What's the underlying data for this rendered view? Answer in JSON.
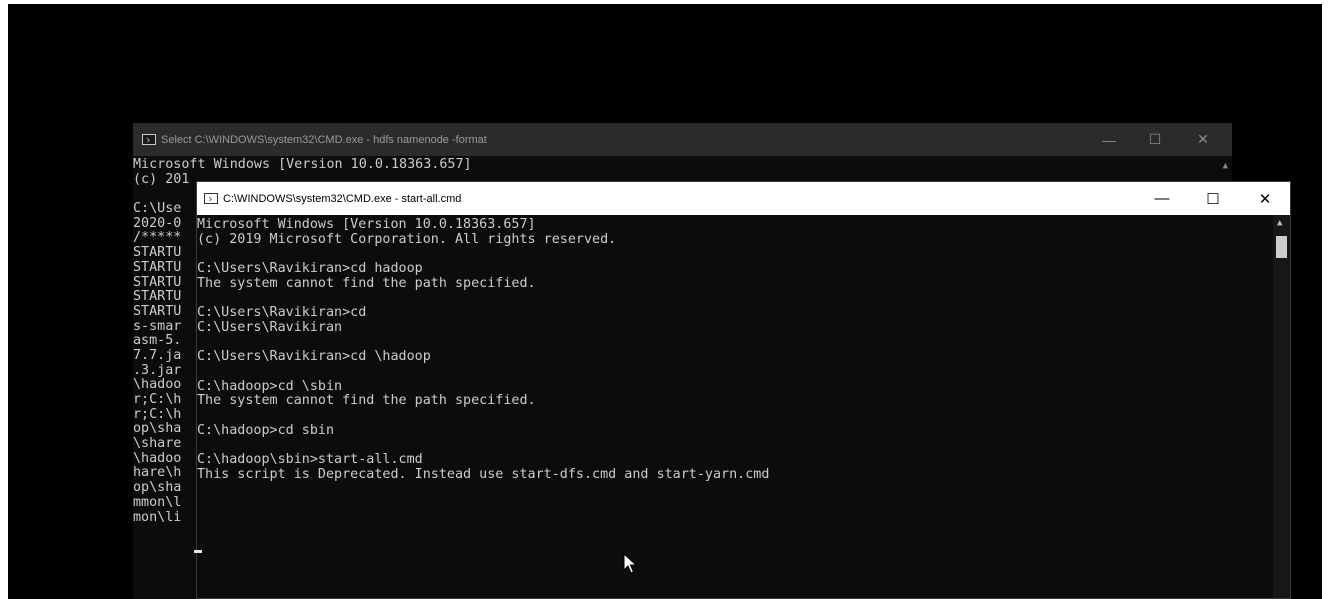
{
  "back_window": {
    "title": "Select C:\\WINDOWS\\system32\\CMD.exe - hdfs  namenode -format",
    "lines": [
      "Microsoft Windows [Version 10.0.18363.657]",
      "(c) 201",
      "",
      "C:\\Use",
      "2020-0",
      "/*****",
      "STARTU",
      "STARTU",
      "STARTU",
      "STARTU",
      "STARTU",
      "s-smar",
      "asm-5.",
      "7.7.ja",
      ".3.jar",
      "\\hadoo",
      "r;C:\\h",
      "r;C:\\h",
      "op\\sha",
      "\\share",
      "\\hadoo",
      "hare\\h",
      "op\\sha",
      "mmon\\l",
      "mon\\li"
    ]
  },
  "front_window": {
    "title": "C:\\WINDOWS\\system32\\CMD.exe - start-all.cmd",
    "lines": [
      "Microsoft Windows [Version 10.0.18363.657]",
      "(c) 2019 Microsoft Corporation. All rights reserved.",
      "",
      "C:\\Users\\Ravikiran>cd hadoop",
      "The system cannot find the path specified.",
      "",
      "C:\\Users\\Ravikiran>cd",
      "C:\\Users\\Ravikiran",
      "",
      "C:\\Users\\Ravikiran>cd \\hadoop",
      "",
      "C:\\hadoop>cd \\sbin",
      "The system cannot find the path specified.",
      "",
      "C:\\hadoop>cd sbin",
      "",
      "C:\\hadoop\\sbin>start-all.cmd",
      "This script is Deprecated. Instead use start-dfs.cmd and start-yarn.cmd"
    ]
  },
  "icons": {
    "minimize": "minimize-icon",
    "maximize": "maximize-icon",
    "close": "close-icon",
    "app": "cmd-icon"
  },
  "colors": {
    "console_bg": "#0c0c0c",
    "console_text": "#cccccc",
    "titlebar_active": "#ffffff",
    "titlebar_inactive": "#2b2b2b"
  }
}
